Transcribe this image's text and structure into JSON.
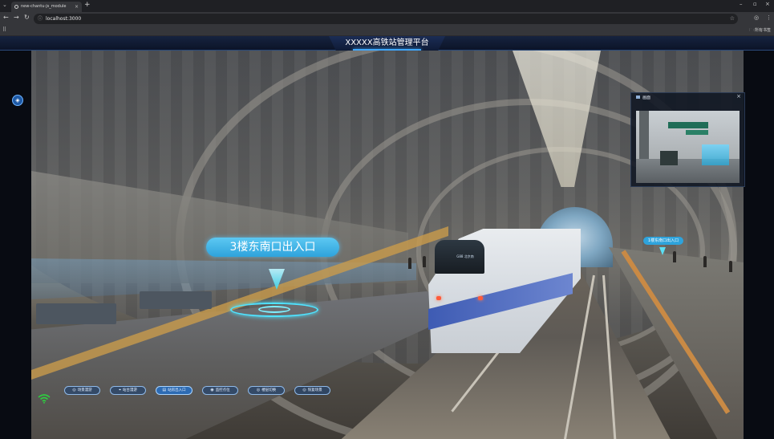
{
  "browser": {
    "tab_title": "new-chantu-js_module",
    "tab_close": "×",
    "new_tab": "+",
    "tab_menu": "⌄",
    "window_controls": [
      "–",
      "▫",
      "×"
    ],
    "nav": {
      "back": "←",
      "forward": "→",
      "reload": "↻"
    },
    "url": "localhost:3000",
    "star": "☆",
    "profile": "◎",
    "menu": "⋮",
    "apps": "⠿",
    "bookmarks_folder": "所有书签"
  },
  "header": {
    "title": "XXXXX高铁站管理平台"
  },
  "scene": {
    "poi_label": "3楼东南口出入口",
    "poi_label_small": "1楼东南口出入口",
    "train_destination": "G88 北京南"
  },
  "camera_panel": {
    "title": "画面",
    "close": "×"
  },
  "controls": {
    "buttons": [
      {
        "label": "场景漫游",
        "icon": "◎"
      },
      {
        "label": "站台漫游",
        "icon": "⌖"
      },
      {
        "label": "站房出入口",
        "icon": "▤"
      },
      {
        "label": "监控点位",
        "icon": "◉"
      },
      {
        "label": "楼层切换",
        "icon": "◎"
      },
      {
        "label": "恢复场景",
        "icon": "◎"
      }
    ]
  },
  "colors": {
    "accent": "#3fa7ff",
    "poi": "#2ea3dc",
    "signal": "#2ecc40"
  }
}
